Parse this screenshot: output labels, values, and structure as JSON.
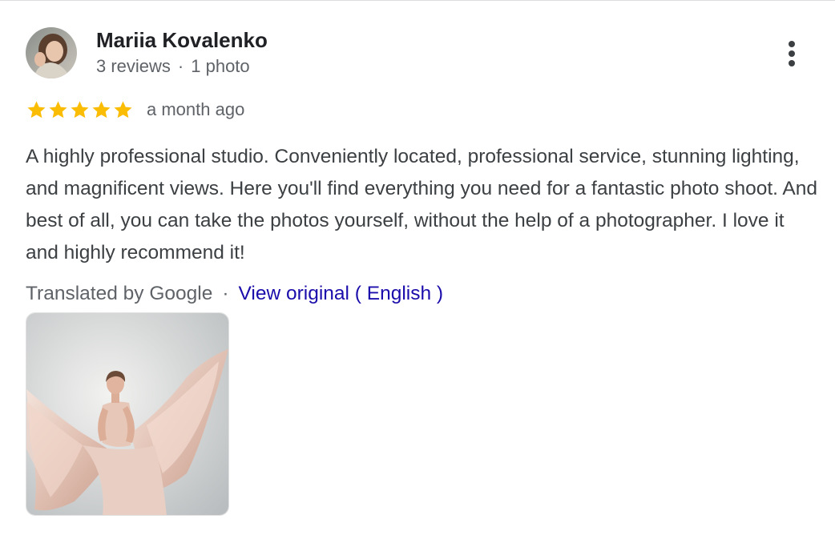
{
  "review": {
    "author": {
      "name": "Mariia Kovalenko",
      "reviews_count": "3 reviews",
      "separator": "·",
      "photos_count": "1 photo",
      "avatar_icon": "user-avatar-photo"
    },
    "menu_icon": "more-vert-icon",
    "rating": {
      "stars": 5,
      "max_stars": 5,
      "star_color": "#fbbc04"
    },
    "time_ago": "a month ago",
    "text": "A highly professional studio. Conveniently located, professional service, stunning lighting, and magnificent views. Here you'll find everything you need for a fantastic photo shoot. And best of all, you can take the photos yourself, without the help of a photographer. I love it and highly recommend it!",
    "translation": {
      "translated_by": "Translated by Google",
      "separator": "·",
      "view_original": "View original ( English )"
    },
    "photo": {
      "icon": "review-photo-thumbnail"
    },
    "colors": {
      "link": "#1a0dab",
      "secondary_text": "#5f6368",
      "body_text": "#3c4043"
    }
  }
}
